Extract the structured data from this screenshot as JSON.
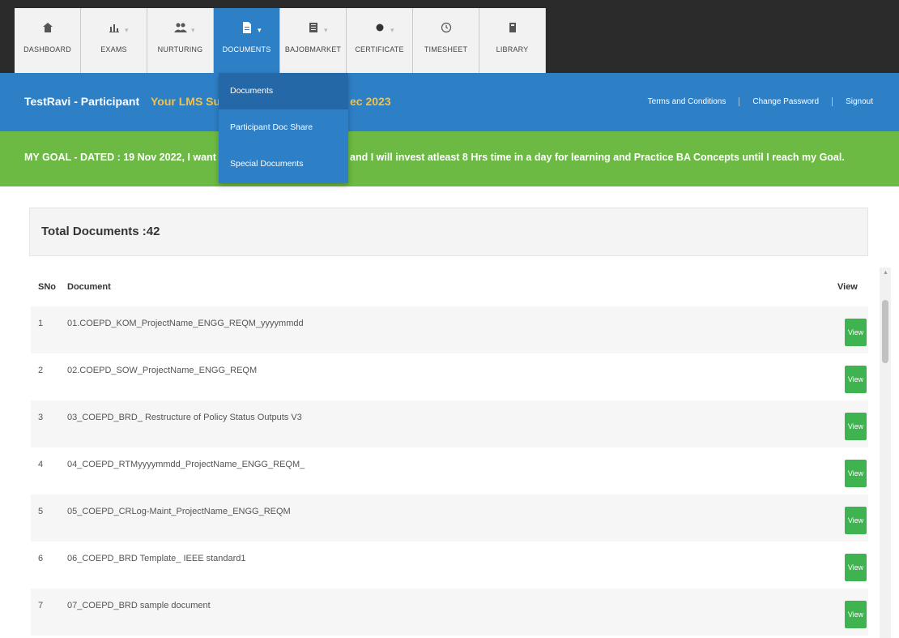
{
  "nav": {
    "tabs": [
      {
        "label": "DASHBOARD",
        "icon": "dashboard-icon",
        "caret": false
      },
      {
        "label": "EXAMS",
        "icon": "chart-icon",
        "caret": true
      },
      {
        "label": "NURTURING",
        "icon": "people-icon",
        "caret": true
      },
      {
        "label": "DOCUMENTS",
        "icon": "document-icon",
        "caret": true,
        "active": true
      },
      {
        "label": "BAJOBMARKET",
        "icon": "briefcase-icon",
        "caret": true
      },
      {
        "label": "CERTIFICATE",
        "icon": "badge-icon",
        "caret": true
      },
      {
        "label": "TIMESHEET",
        "icon": "clock-icon",
        "caret": false
      },
      {
        "label": "LIBRARY",
        "icon": "book-icon",
        "caret": false
      }
    ]
  },
  "dropdown": {
    "items": [
      "Documents",
      "Participant Doc Share",
      "Special Documents"
    ]
  },
  "header": {
    "participant": "TestRavi - Participant",
    "lms_left": "Your LMS Sub",
    "lms_right": "ec 2023",
    "links": [
      "Terms and Conditions",
      "Change Password",
      "Signout"
    ]
  },
  "goal": {
    "left": "MY GOAL - DATED : 19 Nov 2022, I want To",
    "right": "and I will invest atleast 8 Hrs time in a day for learning and Practice BA Concepts until I reach my Goal."
  },
  "panel": {
    "title": "Total Documents :42"
  },
  "table": {
    "headers": {
      "sno": "SNo",
      "document": "Document",
      "view": "View"
    },
    "view_label": "View",
    "rows": [
      {
        "sno": "1",
        "document": "01.COEPD_KOM_ProjectName_ENGG_REQM_yyyymmdd"
      },
      {
        "sno": "2",
        "document": "02.COEPD_SOW_ProjectName_ENGG_REQM"
      },
      {
        "sno": "3",
        "document": "03_COEPD_BRD_ Restructure of Policy Status Outputs V3"
      },
      {
        "sno": "4",
        "document": "04_COEPD_RTMyyyymmdd_ProjectName_ENGG_REQM_"
      },
      {
        "sno": "5",
        "document": "05_COEPD_CRLog-Maint_ProjectName_ENGG_REQM"
      },
      {
        "sno": "6",
        "document": "06_COEPD_BRD Template_ IEEE standard1"
      },
      {
        "sno": "7",
        "document": "07_COEPD_BRD sample document"
      }
    ]
  },
  "colors": {
    "nav_bg": "#2b2b2b",
    "accent_blue": "#2d7fc6",
    "goal_green": "#6cb943",
    "lms_yellow": "#f5c242",
    "view_button": "#3fb34f"
  }
}
